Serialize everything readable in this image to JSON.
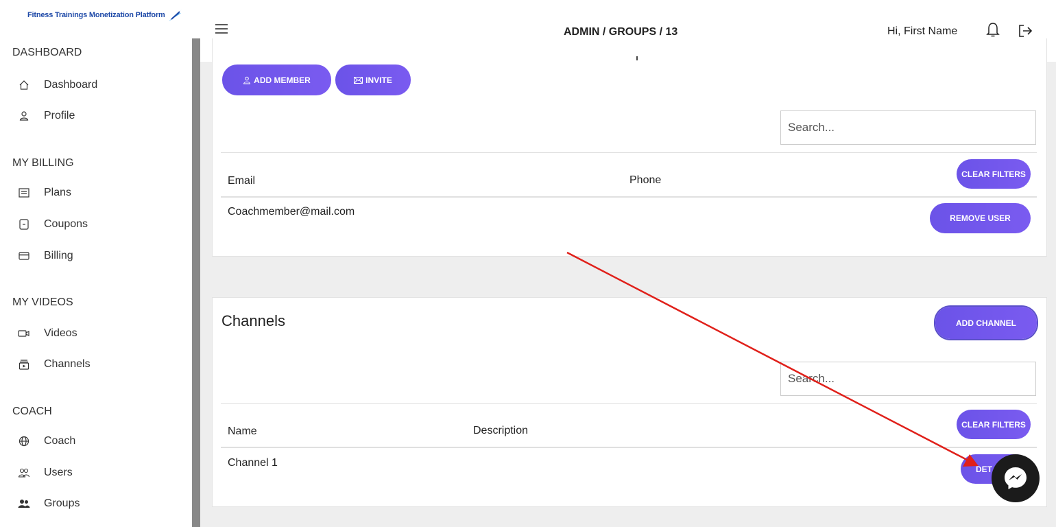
{
  "logo": {
    "text": "Fitness Trainings Monetization Platform"
  },
  "header": {
    "breadcrumb": "ADMIN / GROUPS / 13",
    "greeting": "Hi, First Name"
  },
  "sidebar": {
    "sections": [
      {
        "title": "DASHBOARD",
        "items": [
          {
            "label": "Dashboard",
            "icon": "home-icon"
          },
          {
            "label": "Profile",
            "icon": "user-icon"
          }
        ]
      },
      {
        "title": "MY BILLING",
        "items": [
          {
            "label": "Plans",
            "icon": "list-icon"
          },
          {
            "label": "Coupons",
            "icon": "coupon-icon"
          },
          {
            "label": "Billing",
            "icon": "credit-card-icon"
          }
        ]
      },
      {
        "title": "MY VIDEOS",
        "items": [
          {
            "label": "Videos",
            "icon": "video-icon"
          },
          {
            "label": "Channels",
            "icon": "channels-icon"
          }
        ]
      },
      {
        "title": "COACH",
        "items": [
          {
            "label": "Coach",
            "icon": "globe-icon"
          },
          {
            "label": "Users",
            "icon": "users-icon"
          },
          {
            "label": "Groups",
            "icon": "groups-icon"
          }
        ]
      }
    ]
  },
  "members": {
    "add_member_label": "ADD MEMBER",
    "invite_label": "INVITE",
    "search_placeholder": "Search...",
    "columns": [
      "Email",
      "Phone"
    ],
    "clear_filters_label": "CLEAR FILTERS",
    "rows": [
      {
        "email": "Coachmember@mail.com",
        "phone": "",
        "action": "REMOVE USER"
      }
    ]
  },
  "channels": {
    "title": "Channels",
    "add_channel_label": "ADD CHANNEL",
    "search_placeholder": "Search...",
    "columns": [
      "Name",
      "Description"
    ],
    "clear_filters_label": "CLEAR FILTERS",
    "rows": [
      {
        "name": "Channel 1",
        "description": "",
        "action": "DET"
      }
    ]
  },
  "colors": {
    "accent": "#6b53e8",
    "annotation_arrow": "#e0201a",
    "sidebar_text": "#333333",
    "main_bg": "#eeeeee"
  }
}
